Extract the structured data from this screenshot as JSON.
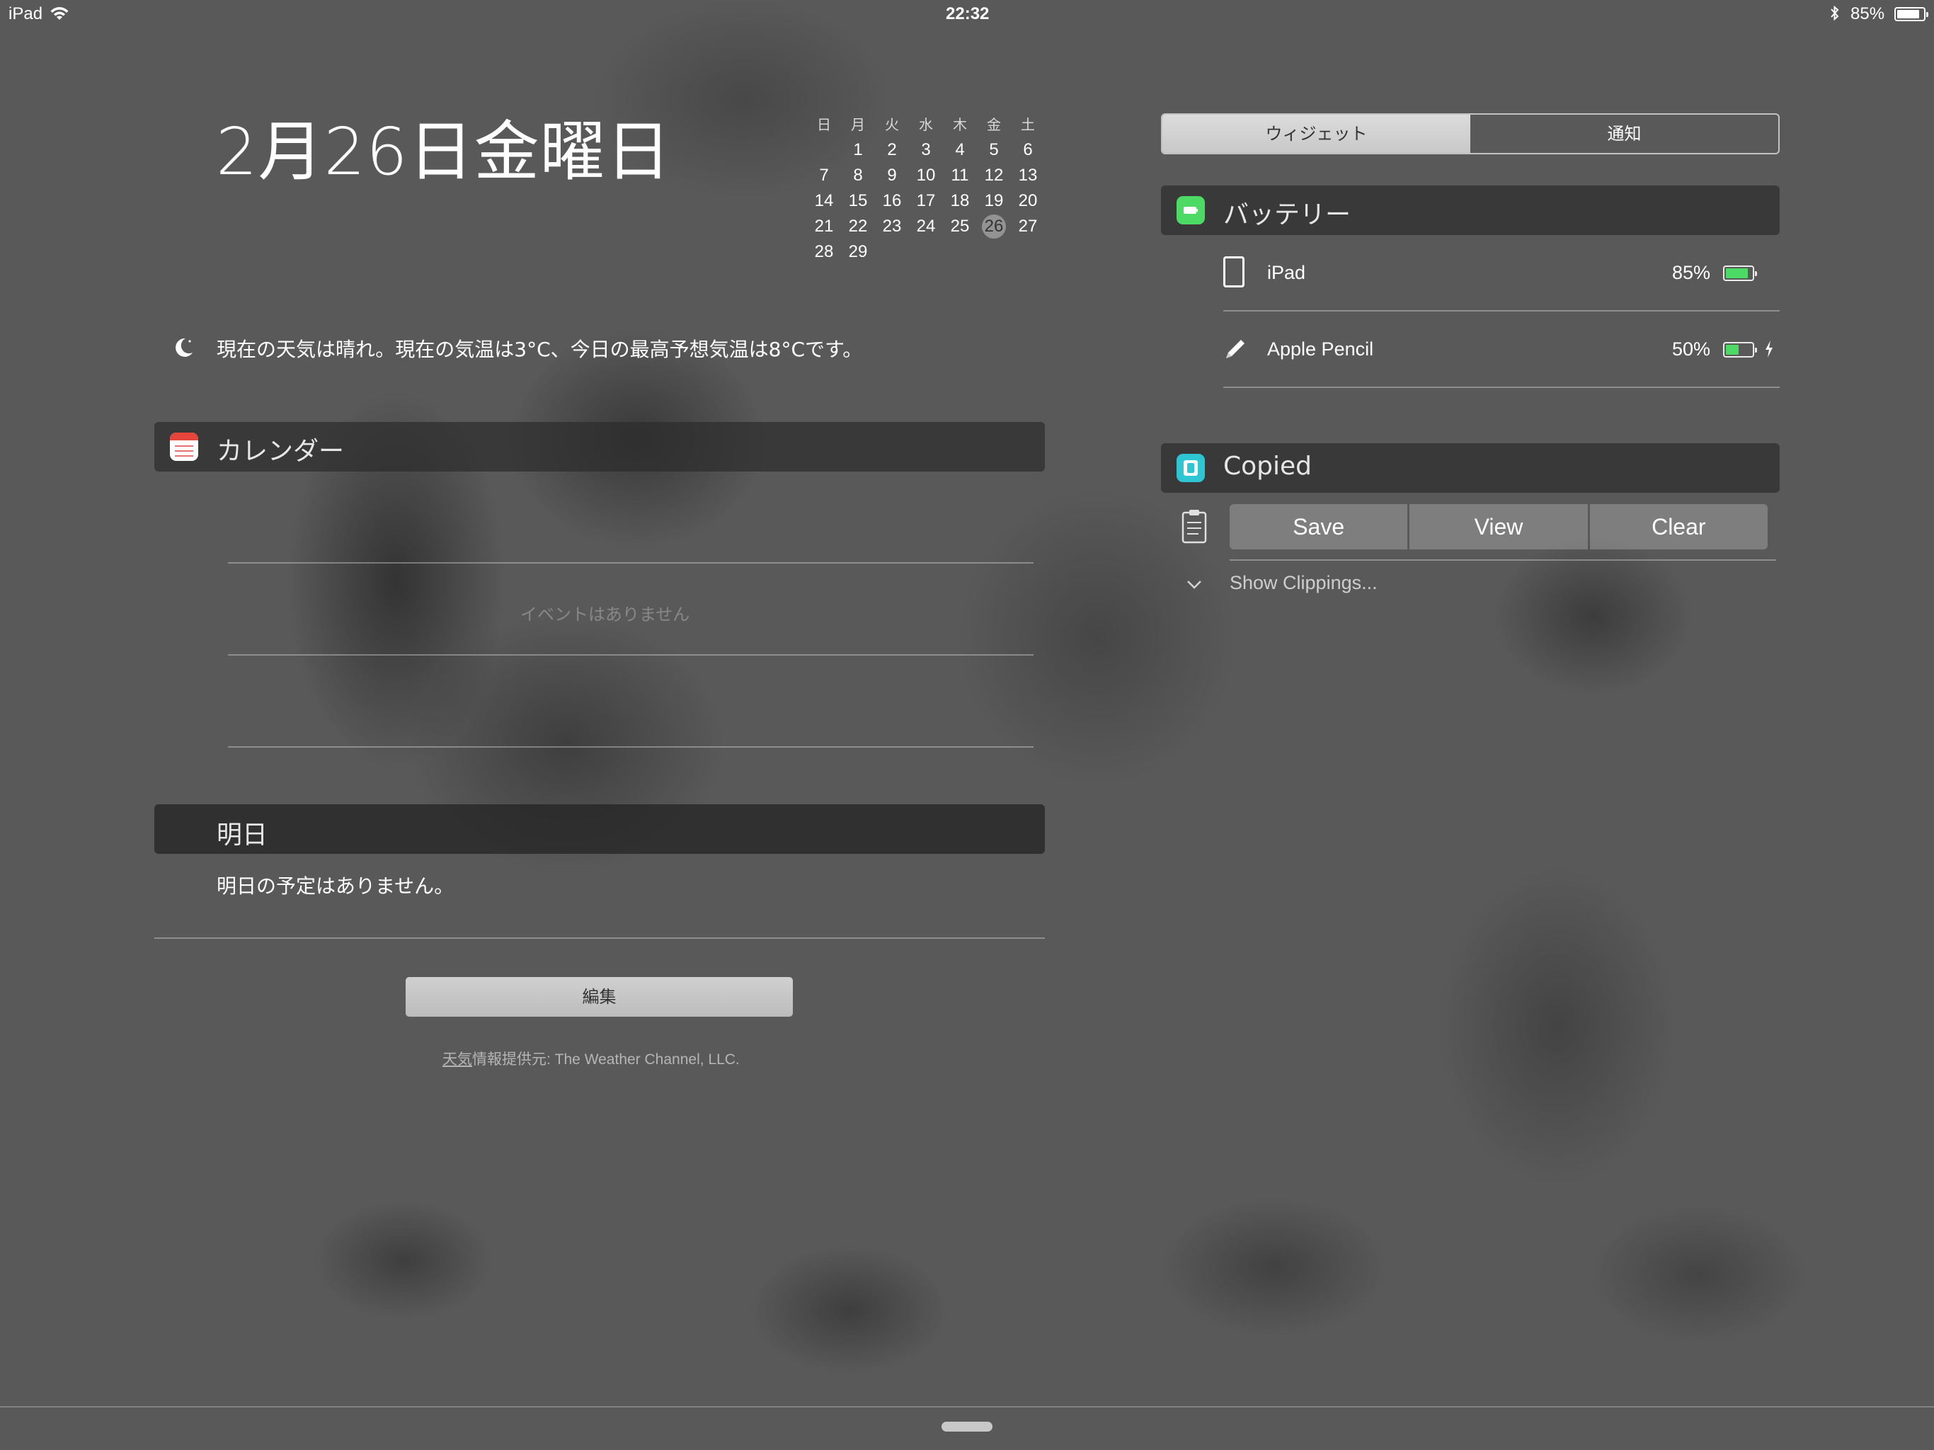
{
  "status_bar": {
    "device": "iPad",
    "time": "22:32",
    "battery_pct": "85%",
    "battery_level": 0.85
  },
  "today": {
    "date_text": "2月26日金曜日",
    "calendar": {
      "weekdays": [
        "日",
        "月",
        "火",
        "水",
        "木",
        "金",
        "土"
      ],
      "first_day_offset": 1,
      "days": [
        "1",
        "2",
        "3",
        "4",
        "5",
        "6",
        "7",
        "8",
        "9",
        "10",
        "11",
        "12",
        "13",
        "14",
        "15",
        "16",
        "17",
        "18",
        "19",
        "20",
        "21",
        "22",
        "23",
        "24",
        "25",
        "26",
        "27",
        "28",
        "29"
      ],
      "today": "26"
    },
    "weather": "現在の天気は晴れ。現在の気温は3°C、今日の最高予想気温は8°Cです。"
  },
  "calendar_widget": {
    "title": "カレンダー",
    "empty_text": "イベントはありません"
  },
  "tomorrow_widget": {
    "title": "明日",
    "text": "明日の予定はありません。"
  },
  "edit_button": "編集",
  "credit": {
    "link": "天気",
    "text": "情報提供元: The Weather Channel, LLC."
  },
  "segmented": {
    "widgets": "ウィジェット",
    "notifications": "通知"
  },
  "battery_widget": {
    "title": "バッテリー",
    "devices": [
      {
        "name": "iPad",
        "pct": "85%",
        "level": 0.85
      },
      {
        "name": "Apple Pencil",
        "pct": "50%",
        "level": 0.5
      }
    ]
  },
  "copied_widget": {
    "title": "Copied",
    "buttons": [
      "Save",
      "View",
      "Clear"
    ],
    "show_clippings": "Show Clippings..."
  },
  "colors": {
    "battery_green": "#4cd964",
    "copied_teal": "#2ec6d3",
    "calendar_red": "#e5453a"
  }
}
